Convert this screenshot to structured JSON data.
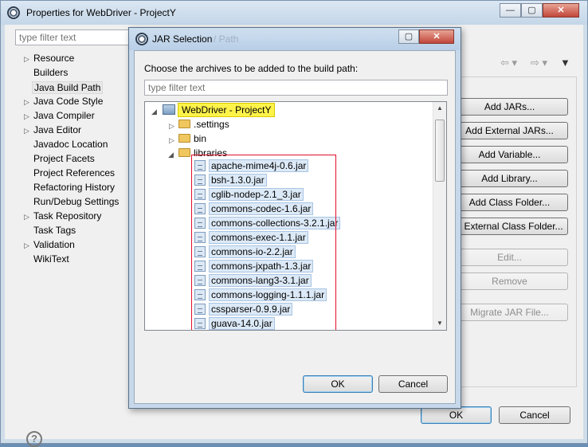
{
  "outer": {
    "title": "Properties for WebDriver - ProjectY",
    "filter_placeholder": "type filter text",
    "tree": [
      {
        "label": "Resource",
        "expandable": true
      },
      {
        "label": "Builders",
        "expandable": false
      },
      {
        "label": "Java Build Path",
        "expandable": false,
        "selected": true
      },
      {
        "label": "Java Code Style",
        "expandable": true
      },
      {
        "label": "Java Compiler",
        "expandable": true
      },
      {
        "label": "Java Editor",
        "expandable": true
      },
      {
        "label": "Javadoc Location",
        "expandable": false
      },
      {
        "label": "Project Facets",
        "expandable": false
      },
      {
        "label": "Project References",
        "expandable": false
      },
      {
        "label": "Refactoring History",
        "expandable": false
      },
      {
        "label": "Run/Debug Settings",
        "expandable": false
      },
      {
        "label": "Task Repository",
        "expandable": true
      },
      {
        "label": "Task Tags",
        "expandable": false
      },
      {
        "label": "Validation",
        "expandable": true
      },
      {
        "label": "WikiText",
        "expandable": false
      }
    ],
    "buttons": {
      "add_jars": "Add JARs...",
      "add_external_jars": "Add External JARs...",
      "add_variable": "Add Variable...",
      "add_library": "Add Library...",
      "add_class_folder": "Add Class Folder...",
      "add_external_class_folder": "d External Class Folder...",
      "edit": "Edit...",
      "remove": "Remove",
      "migrate_jar": "Migrate JAR File...",
      "ok": "OK",
      "cancel": "Cancel"
    },
    "window_buttons": {
      "minimize": "—",
      "maximize": "▢",
      "close": "✕"
    }
  },
  "dialog": {
    "title": "JAR Selection",
    "title_ghost": "/ Path",
    "instruction": "Choose the archives to be added to the build path:",
    "filter_placeholder": "type filter text",
    "project": "WebDriver - ProjectY",
    "folders": [
      ".settings",
      "bin",
      "libraries"
    ],
    "jars": [
      "apache-mime4j-0.6.jar",
      "bsh-1.3.0.jar",
      "cglib-nodep-2.1_3.jar",
      "commons-codec-1.6.jar",
      "commons-collections-3.2.1.jar",
      "commons-exec-1.1.jar",
      "commons-io-2.2.jar",
      "commons-jxpath-1.3.jar",
      "commons-lang3-3.1.jar",
      "commons-logging-1.1.1.jar",
      "cssparser-0.9.9.jar",
      "guava-14.0.jar"
    ],
    "ok": "OK",
    "cancel": "Cancel",
    "window_buttons": {
      "maximize": "▢",
      "close": "✕"
    }
  },
  "colors": {
    "highlight": "#fff34a",
    "selection_box": "#e0102c"
  }
}
